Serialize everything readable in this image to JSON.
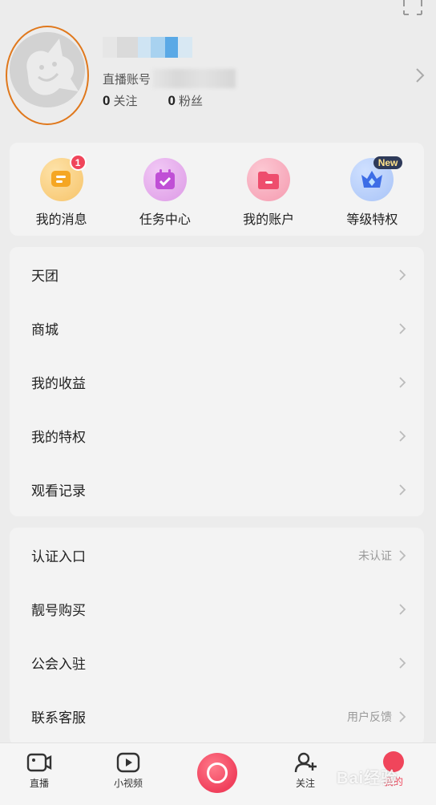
{
  "profile": {
    "account_prefix": "直播账号",
    "following_count": "0",
    "following_label": "关注",
    "fans_count": "0",
    "fans_label": "粉丝"
  },
  "quick_actions": [
    {
      "label": "我的消息",
      "icon": "message-icon",
      "badge": "1",
      "color": "#f6b23c"
    },
    {
      "label": "任务中心",
      "icon": "task-calendar-icon",
      "color": "#c65ad8"
    },
    {
      "label": "我的账户",
      "icon": "wallet-folder-icon",
      "color": "#f0506e"
    },
    {
      "label": "等级特权",
      "icon": "level-crown-icon",
      "badge": "New",
      "color": "#4a7ef0"
    }
  ],
  "menu_group_1": [
    {
      "label": "天团"
    },
    {
      "label": "商城"
    },
    {
      "label": "我的收益"
    },
    {
      "label": "我的特权"
    },
    {
      "label": "观看记录"
    }
  ],
  "menu_group_2": [
    {
      "label": "认证入口",
      "extra": "未认证"
    },
    {
      "label": "靓号购买"
    },
    {
      "label": "公会入驻"
    },
    {
      "label": "联系客服",
      "extra": "用户反馈"
    }
  ],
  "bottom_nav": [
    {
      "label": "直播",
      "icon": "tv-icon"
    },
    {
      "label": "小视频",
      "icon": "video-play-icon"
    },
    {
      "label": "",
      "icon": "go-live-icon"
    },
    {
      "label": "关注",
      "icon": "user-add-icon"
    },
    {
      "label": "我的",
      "icon": "mine-icon"
    }
  ],
  "watermark": "Bai经验",
  "colors": {
    "accent": "#f0455b",
    "avatar_ring": "#e0781c",
    "background": "#ececec",
    "card": "#f3f3f3"
  }
}
